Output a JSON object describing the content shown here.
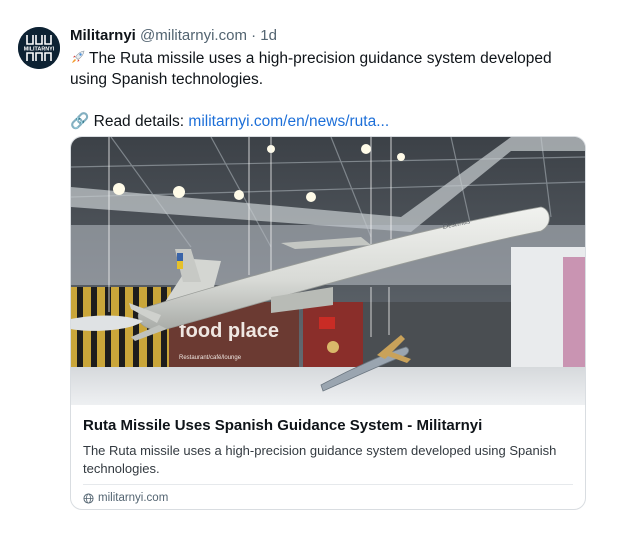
{
  "author": {
    "name": "Militarnyi",
    "handle": "@militarnyi.com",
    "separator": "·",
    "time": "1d",
    "avatar_text": "MILITARNYI",
    "avatar_icon": "militarnyi-logo-icon"
  },
  "post": {
    "emoji_icon": "missile-rocket-icon",
    "text": "The Ruta missile uses a high-precision guidance system developed using Spanish technologies.",
    "link_emoji": "🔗",
    "link_prefix": "Read details:",
    "link_text": "militarnyi.com/en/news/ruta..."
  },
  "card": {
    "image_icon": "ruta-missile-photo",
    "title": "Ruta Missile Uses Spanish Guidance System - Militarnyi",
    "description": "The Ruta missile uses a high-precision guidance system developed using Spanish technologies.",
    "domain_icon": "globe-icon",
    "domain": "militarnyi.com"
  },
  "colors": {
    "link": "#1d6fd8",
    "muted": "#536471",
    "avatar_bg": "#0d2233"
  }
}
